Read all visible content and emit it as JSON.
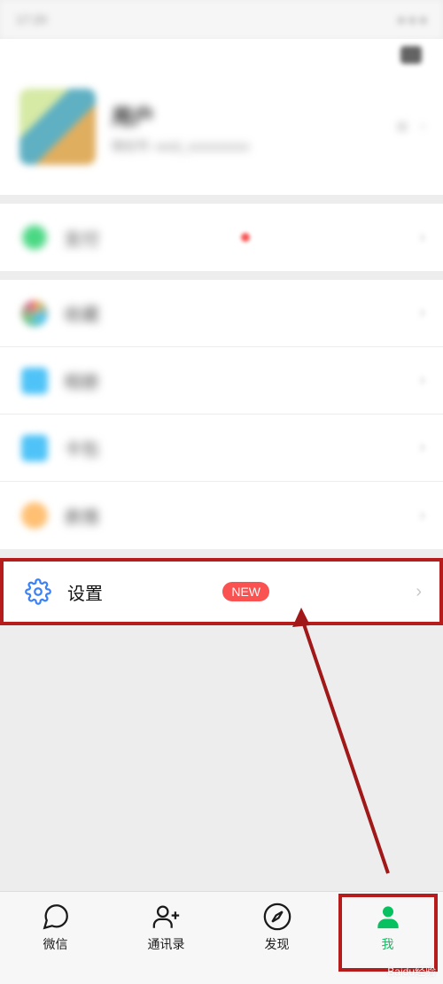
{
  "status": {
    "time": "17:20"
  },
  "profile": {
    "name": "用户",
    "id": "微信号: wxid_xxxxxxxxxx"
  },
  "sections": {
    "pay": "支付",
    "favorites": "收藏",
    "photos": "相册",
    "cards": "卡包",
    "emoji": "表情"
  },
  "settings": {
    "label": "设置",
    "badge": "NEW"
  },
  "tabs": {
    "chat": "微信",
    "contacts": "通讯录",
    "discover": "发现",
    "me": "我"
  },
  "watermark": "Baidu经验"
}
